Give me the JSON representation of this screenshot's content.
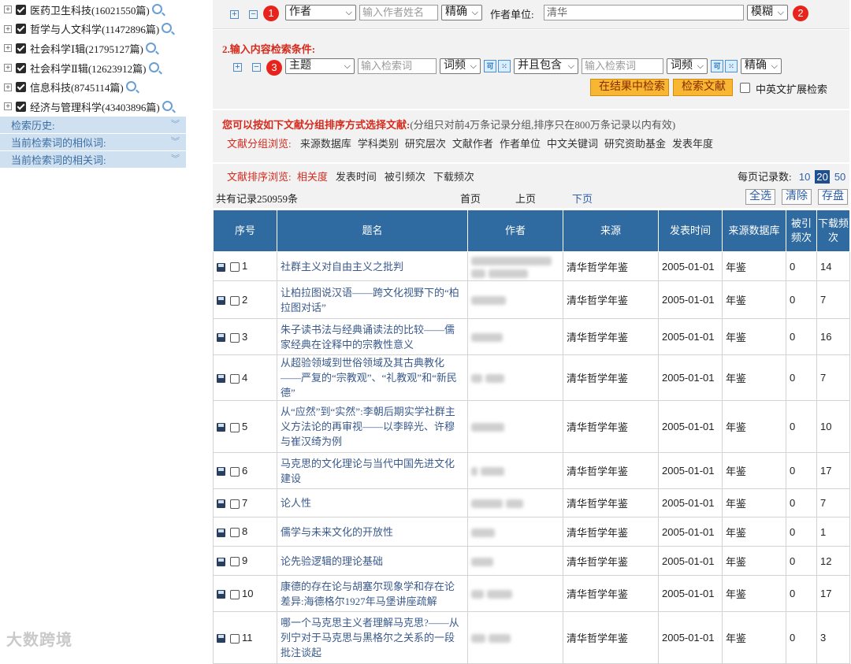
{
  "sidebar": {
    "categories": [
      {
        "label": "医药卫生科技(16021550篇)"
      },
      {
        "label": "哲学与人文科学(11472896篇)"
      },
      {
        "label": "社会科学Ⅰ辑(21795127篇)"
      },
      {
        "label": "社会科学Ⅱ辑(12623912篇)"
      },
      {
        "label": "信息科技(8745114篇)"
      },
      {
        "label": "经济与管理科学(43403896篇)"
      }
    ],
    "sections": [
      "检索历史:",
      "当前检索词的相似词:",
      "当前检索词的相关词:"
    ]
  },
  "author_row": {
    "marker": "1",
    "field_select": "作者",
    "name_placeholder": "输入作者姓名",
    "match_select": "精确",
    "unit_label": "作者单位:",
    "unit_value": "清华",
    "unit_match_select": "模糊",
    "marker2": "2"
  },
  "content_section": {
    "title": "2.输入内容检索条件:",
    "marker": "3",
    "field_select": "主题",
    "keyword_placeholder": "输入检索词",
    "freq_select": "词频",
    "logic_select": "并且包含",
    "keyword2_placeholder": "输入检索词",
    "freq2_select": "词频",
    "match_select": "精确",
    "search_in_results": "在结果中检索",
    "search_button": "检索文献",
    "expand_label": "中英文扩展检索"
  },
  "grouping": {
    "intro": "您可以按如下文献分组排序方式选择文献:",
    "note": "(分组只对前4万条记录分组,排序只在800万条记录以内有效)",
    "browse_label": "文献分组浏览:",
    "groups": [
      "来源数据库",
      "学科类别",
      "研究层次",
      "文献作者",
      "作者单位",
      "中文关键词",
      "研究资助基金",
      "发表年度"
    ]
  },
  "sorting": {
    "label": "文献排序浏览:",
    "options": [
      "相关度",
      "发表时间",
      "被引频次",
      "下载频次"
    ],
    "per_page_label": "每页记录数:",
    "per_page": [
      "10",
      "20",
      "50"
    ],
    "per_page_selected": "20"
  },
  "pager": {
    "total": "共有记录250959条",
    "first": "首页",
    "prev": "上页",
    "next": "下页",
    "select_all": "全选",
    "clear": "清除",
    "save": "存盘"
  },
  "table": {
    "headers": [
      "序号",
      "题名",
      "作者",
      "来源",
      "发表时间",
      "来源数据库",
      "被引频次",
      "下载频次"
    ],
    "rows": [
      {
        "no": "1",
        "title": "社群主义对自由主义之批判",
        "source": "清华哲学年鉴",
        "date": "2005-01-01",
        "db": "年鉴",
        "cited": "0",
        "downloads": "14"
      },
      {
        "no": "2",
        "title": "让柏拉图说汉语——跨文化视野下的“柏拉图对话”",
        "source": "清华哲学年鉴",
        "date": "2005-01-01",
        "db": "年鉴",
        "cited": "0",
        "downloads": "7"
      },
      {
        "no": "3",
        "title": "朱子读书法与经典诵读法的比较——儒家经典在诠释中的宗教性意义",
        "source": "清华哲学年鉴",
        "date": "2005-01-01",
        "db": "年鉴",
        "cited": "0",
        "downloads": "16"
      },
      {
        "no": "4",
        "title": "从超验领域到世俗领域及其古典教化——严复的“宗教观”、“礼教观”和“新民德”",
        "source": "清华哲学年鉴",
        "date": "2005-01-01",
        "db": "年鉴",
        "cited": "0",
        "downloads": "7"
      },
      {
        "no": "5",
        "title": "从“应然”到“实然”:李朝后期实学社群主义方法论的再审视——以李睟光、许穆与崔汉绮为例",
        "source": "清华哲学年鉴",
        "date": "2005-01-01",
        "db": "年鉴",
        "cited": "0",
        "downloads": "10"
      },
      {
        "no": "6",
        "title": "马克思的文化理论与当代中国先进文化建设",
        "source": "清华哲学年鉴",
        "date": "2005-01-01",
        "db": "年鉴",
        "cited": "0",
        "downloads": "17"
      },
      {
        "no": "7",
        "title": "论人性",
        "source": "清华哲学年鉴",
        "date": "2005-01-01",
        "db": "年鉴",
        "cited": "0",
        "downloads": "7"
      },
      {
        "no": "8",
        "title": "儒学与未来文化的开放性",
        "source": "清华哲学年鉴",
        "date": "2005-01-01",
        "db": "年鉴",
        "cited": "0",
        "downloads": "1"
      },
      {
        "no": "9",
        "title": "论先验逻辑的理论基础",
        "source": "清华哲学年鉴",
        "date": "2005-01-01",
        "db": "年鉴",
        "cited": "0",
        "downloads": "12"
      },
      {
        "no": "10",
        "title": "康德的存在论与胡塞尔现象学和存在论差异:海德格尔1927年马堡讲座疏解",
        "source": "清华哲学年鉴",
        "date": "2005-01-01",
        "db": "年鉴",
        "cited": "0",
        "downloads": "17"
      },
      {
        "no": "11",
        "title": "哪一个马克思主义者理解马克思?——从列宁对于马克思与黑格尔之关系的一段批注谈起",
        "source": "清华哲学年鉴",
        "date": "2005-01-01",
        "db": "年鉴",
        "cited": "0",
        "downloads": "3"
      }
    ]
  },
  "watermark": "大数跨境"
}
